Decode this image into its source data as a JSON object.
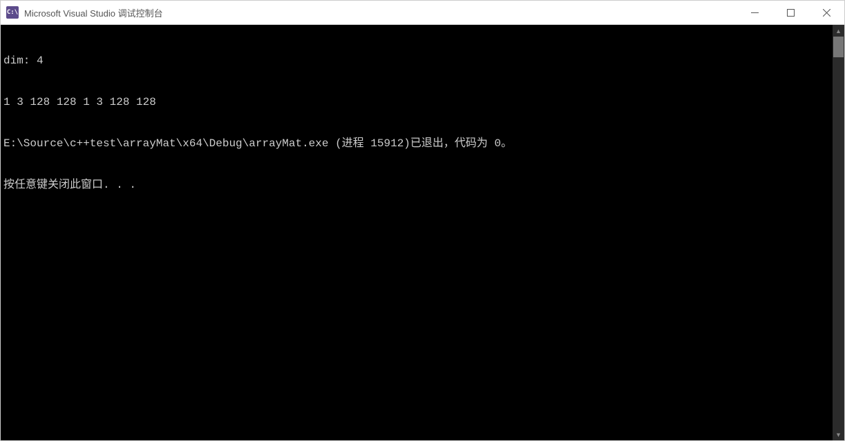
{
  "window": {
    "title": "Microsoft Visual Studio 调试控制台",
    "icon_text": "C:\\"
  },
  "console": {
    "lines": [
      "dim: 4",
      "1 3 128 128 1 3 128 128",
      "E:\\Source\\c++test\\arrayMat\\x64\\Debug\\arrayMat.exe (进程 15912)已退出，代码为 0。",
      "按任意键关闭此窗口. . ."
    ]
  }
}
